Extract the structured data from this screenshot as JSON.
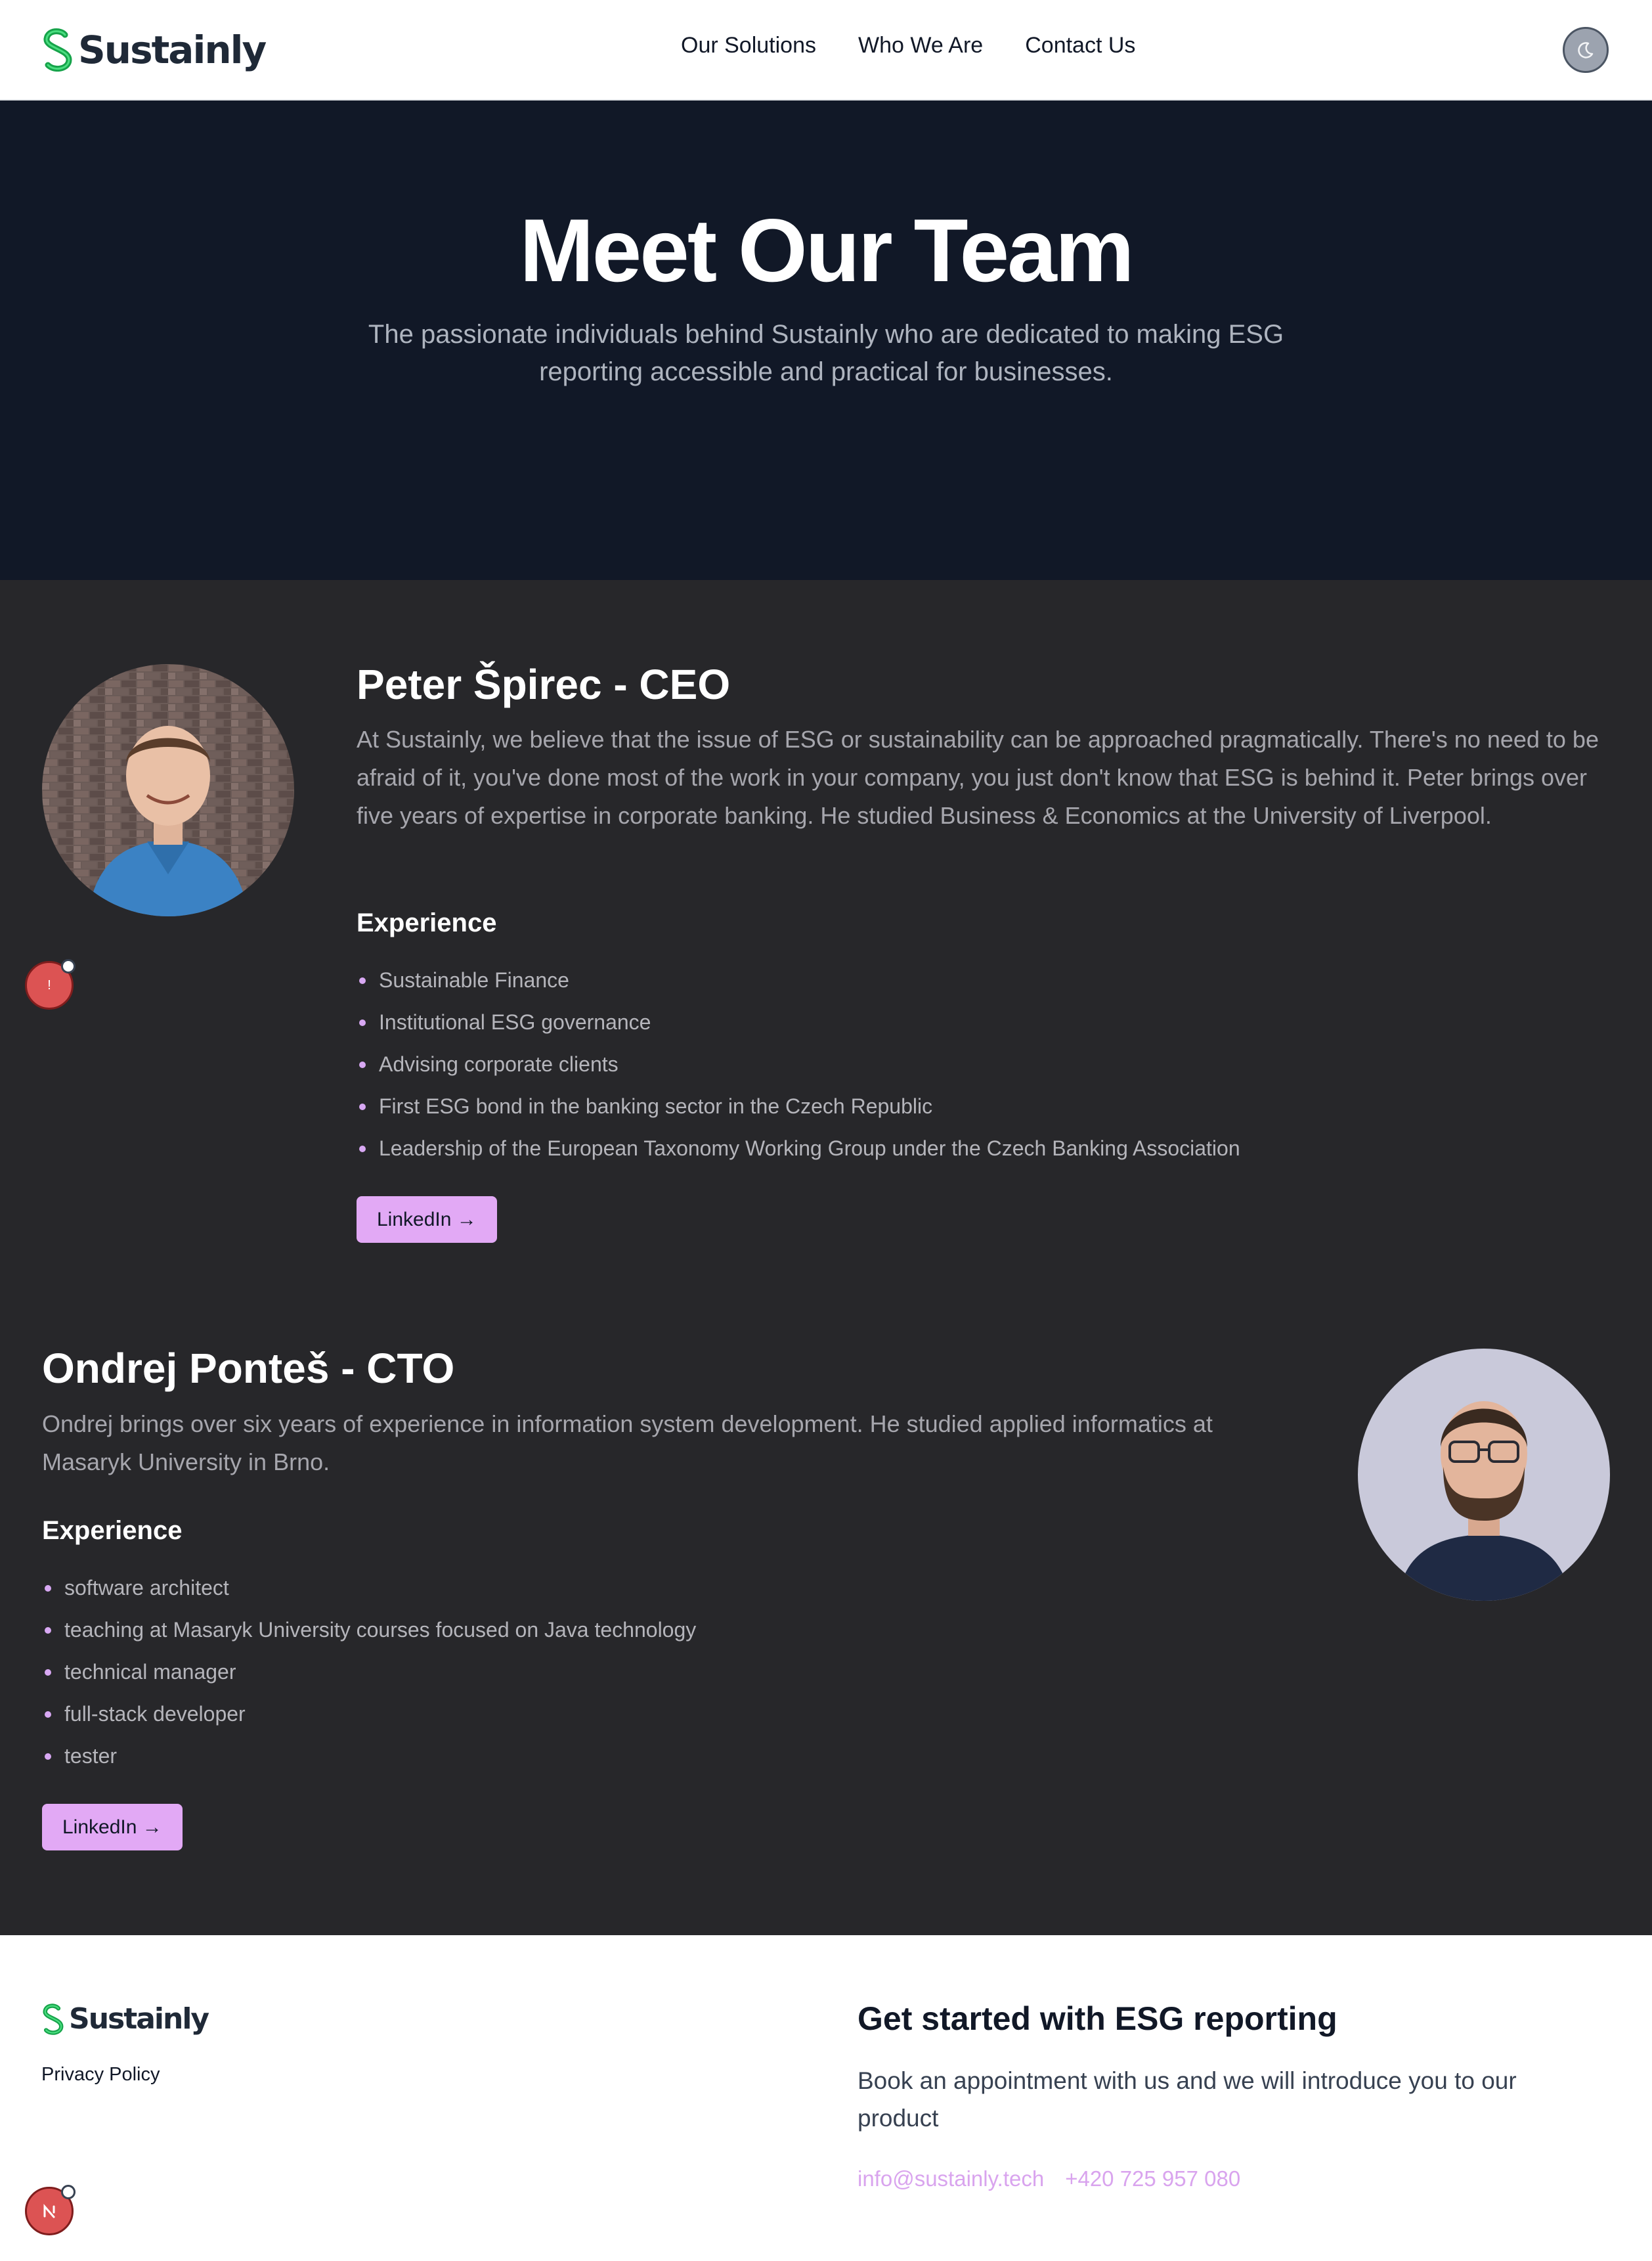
{
  "brand": {
    "name": "Sustainly",
    "accent": "#e2a9f5",
    "logo_green": "#22c55e"
  },
  "nav": {
    "links": [
      "Our Solutions",
      "Who We Are",
      "Contact Us"
    ],
    "theme_toggle_icon": "moon-icon"
  },
  "hero": {
    "title": "Meet Our Team",
    "subtitle": "The passionate individuals behind Sustainly who are dedicated to making ESG reporting accessible and practical for businesses."
  },
  "members": [
    {
      "name": "Peter Špirec - CEO",
      "bio": "At Sustainly, we believe that the issue of ESG or sustainability can be approached pragmatically. There's no need to be afraid of it, you've done most of the work in your company, you just don't know that ESG is behind it. Peter brings over five years of expertise in corporate banking. He studied Business & Economics at the University of Liverpool.",
      "experience_heading": "Experience",
      "experience": [
        "Sustainable Finance",
        "Institutional ESG governance",
        "Advising corporate clients",
        "First ESG bond in the banking sector in the Czech Republic",
        "Leadership of the European Taxonomy Working Group under the Czech Banking Association"
      ],
      "linkedin_label": "LinkedIn →"
    },
    {
      "name": "Ondrej Ponteš - CTO",
      "bio": "Ondrej brings over six years of experience in information system development. He studied applied informatics at Masaryk University in Brno.",
      "experience_heading": "Experience",
      "experience": [
        "software architect",
        "teaching at Masaryk University courses focused on Java technology",
        "technical manager",
        "full-stack developer",
        "tester"
      ],
      "linkedin_label": "LinkedIn →"
    }
  ],
  "footer": {
    "privacy": "Privacy Policy",
    "cta_title": "Get started with ESG reporting",
    "cta_text": "Book an appointment with us and we will introduce you to our product",
    "email": "info@sustainly.tech",
    "phone": "+420 725 957 080"
  },
  "notification": {
    "glyph": "!"
  }
}
